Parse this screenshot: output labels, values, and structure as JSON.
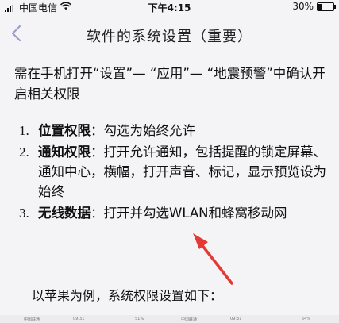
{
  "status_bar": {
    "carrier": "中国电信",
    "time": "下午4:15",
    "battery_text": "30%",
    "battery_level": 0.3,
    "signal_icon": "signal-icon",
    "wifi_icon": "wifi-icon"
  },
  "nav": {
    "back_icon": "back-chevron-icon",
    "title": "软件的系统设置（重要）"
  },
  "content": {
    "intro": "需在手机打开“设置”— “应用”— “地震预警”中确认开启相关权限",
    "items": [
      {
        "num": "1.",
        "key": "位置权限",
        "text": "：勾选为始终允许"
      },
      {
        "num": "2.",
        "key": "通知权限",
        "text": "：打开允许通知，包括提醒的锁定屏幕、通知中心，横幅，打开声音、标记，显示预览设为始终"
      },
      {
        "num": "3.",
        "key": "无线数据",
        "text": "：打开并勾选WLAN和蜂窝移动网"
      }
    ],
    "footer_note": "以苹果为例，系统权限设置如下：",
    "arrow_color": "#e53935"
  },
  "thumbnails": {
    "left": {
      "carrier": "中国联通",
      "time": "09:31",
      "battery": "51%"
    },
    "right": {
      "carrier": "中国联通",
      "time": "09:31",
      "battery": "54%"
    }
  }
}
